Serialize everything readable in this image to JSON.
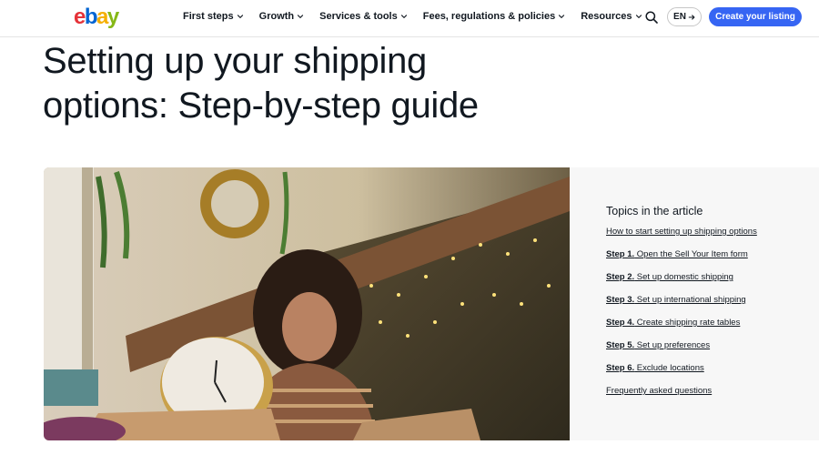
{
  "header": {
    "logo_letters": [
      {
        "char": "e",
        "color": "#e53238"
      },
      {
        "char": "b",
        "color": "#0064d2"
      },
      {
        "char": "a",
        "color": "#f5af02"
      },
      {
        "char": "y",
        "color": "#86b817"
      }
    ],
    "nav": [
      {
        "label": "First steps"
      },
      {
        "label": "Growth"
      },
      {
        "label": "Services & tools"
      },
      {
        "label": "Fees, regulations & policies"
      },
      {
        "label": "Resources"
      }
    ],
    "language_label": "EN",
    "create_listing_label": "Create your listing",
    "accent_color": "#3665f3"
  },
  "main": {
    "title_line1": "Setting up your shipping",
    "title_line2": "options: Step-by-step guide"
  },
  "topics": {
    "heading": "Topics in the article",
    "links": [
      {
        "prefix": "",
        "text": "How to start setting up shipping options"
      },
      {
        "prefix": "Step 1.",
        "text": " Open the Sell Your Item form"
      },
      {
        "prefix": "Step 2.",
        "text": " Set up domestic shipping"
      },
      {
        "prefix": "Step 3.",
        "text": " Set up international shipping"
      },
      {
        "prefix": "Step 4.",
        "text": " Create shipping rate tables"
      },
      {
        "prefix": "Step 5.",
        "text": " Set up preferences"
      },
      {
        "prefix": "Step 6.",
        "text": " Exclude locations"
      },
      {
        "prefix": "",
        "text": "Frequently asked questions"
      }
    ]
  }
}
